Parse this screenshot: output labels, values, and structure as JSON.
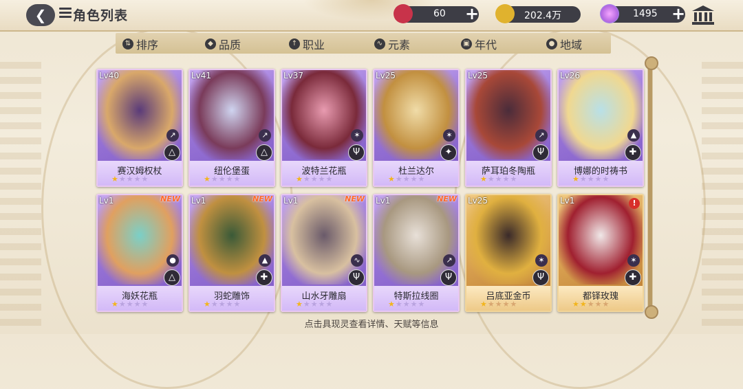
{
  "header": {
    "title": "角色列表"
  },
  "resources": [
    {
      "name": "ticket",
      "value": "60",
      "color": "#c8334a"
    },
    {
      "name": "gold",
      "value": "202.4万",
      "color": "#e0b22e"
    },
    {
      "name": "gem",
      "value": "1495",
      "color": "#b467e0"
    }
  ],
  "filters": [
    {
      "label": "排序",
      "icon": "sort-icon"
    },
    {
      "label": "品质",
      "icon": "quality-icon"
    },
    {
      "label": "职业",
      "icon": "class-icon"
    },
    {
      "label": "元素",
      "icon": "element-icon"
    },
    {
      "label": "年代",
      "icon": "era-icon"
    },
    {
      "label": "地域",
      "icon": "region-icon"
    }
  ],
  "cards": [
    {
      "level": "Lv40",
      "name": "赛汉姆权杖",
      "stars": 1,
      "max_stars": 5,
      "rarity": "purple",
      "new": false,
      "alert": false,
      "element": "crit-icon",
      "job": "delta-icon"
    },
    {
      "level": "Lv41",
      "name": "纽伦堡蛋",
      "stars": 1,
      "max_stars": 5,
      "rarity": "purple",
      "new": false,
      "alert": false,
      "element": "crit-icon",
      "job": "delta-icon"
    },
    {
      "level": "Lv37",
      "name": "波特兰花瓶",
      "stars": 1,
      "max_stars": 5,
      "rarity": "purple",
      "new": false,
      "alert": false,
      "element": "fire-icon",
      "job": "trident-icon"
    },
    {
      "level": "Lv25",
      "name": "杜兰达尔",
      "stars": 1,
      "max_stars": 5,
      "rarity": "purple",
      "new": false,
      "alert": false,
      "element": "fire-icon",
      "job": "shield-icon"
    },
    {
      "level": "Lv25",
      "name": "萨耳珀冬陶瓶",
      "stars": 1,
      "max_stars": 5,
      "rarity": "purple",
      "new": false,
      "alert": false,
      "element": "crit-icon",
      "job": "trident-icon"
    },
    {
      "level": "Lv26",
      "name": "博娜的时祷书",
      "stars": 1,
      "max_stars": 5,
      "rarity": "purple",
      "new": false,
      "alert": false,
      "element": "earth-icon",
      "job": "cross-icon"
    },
    {
      "level": "Lv1",
      "name": "海妖花瓶",
      "stars": 1,
      "max_stars": 5,
      "rarity": "purple",
      "new": true,
      "new_label": "NEW",
      "alert": false,
      "element": "water-icon",
      "job": "delta-icon"
    },
    {
      "level": "Lv1",
      "name": "羽蛇雕饰",
      "stars": 1,
      "max_stars": 5,
      "rarity": "purple",
      "new": true,
      "new_label": "NEW",
      "alert": false,
      "element": "earth-icon",
      "job": "cross-icon"
    },
    {
      "level": "Lv1",
      "name": "山水牙雕扇",
      "stars": 1,
      "max_stars": 5,
      "rarity": "purple",
      "new": true,
      "new_label": "NEW",
      "alert": false,
      "element": "wind-icon",
      "job": "trident-icon"
    },
    {
      "level": "Lv1",
      "name": "特斯拉线圈",
      "stars": 1,
      "max_stars": 5,
      "rarity": "purple",
      "new": true,
      "new_label": "NEW",
      "alert": false,
      "element": "crit-icon",
      "job": "trident-icon"
    },
    {
      "level": "Lv25",
      "name": "吕底亚金币",
      "stars": 1,
      "max_stars": 5,
      "rarity": "gold",
      "new": false,
      "alert": false,
      "element": "fire-icon",
      "job": "trident-icon"
    },
    {
      "level": "Lv1",
      "name": "都铎玫瑰",
      "stars": 2,
      "max_stars": 5,
      "rarity": "gold",
      "new": false,
      "alert": true,
      "alert_label": "!",
      "element": "fire-icon",
      "job": "cross-icon"
    }
  ],
  "hint": "点击具现灵查看详情、天赋等信息"
}
